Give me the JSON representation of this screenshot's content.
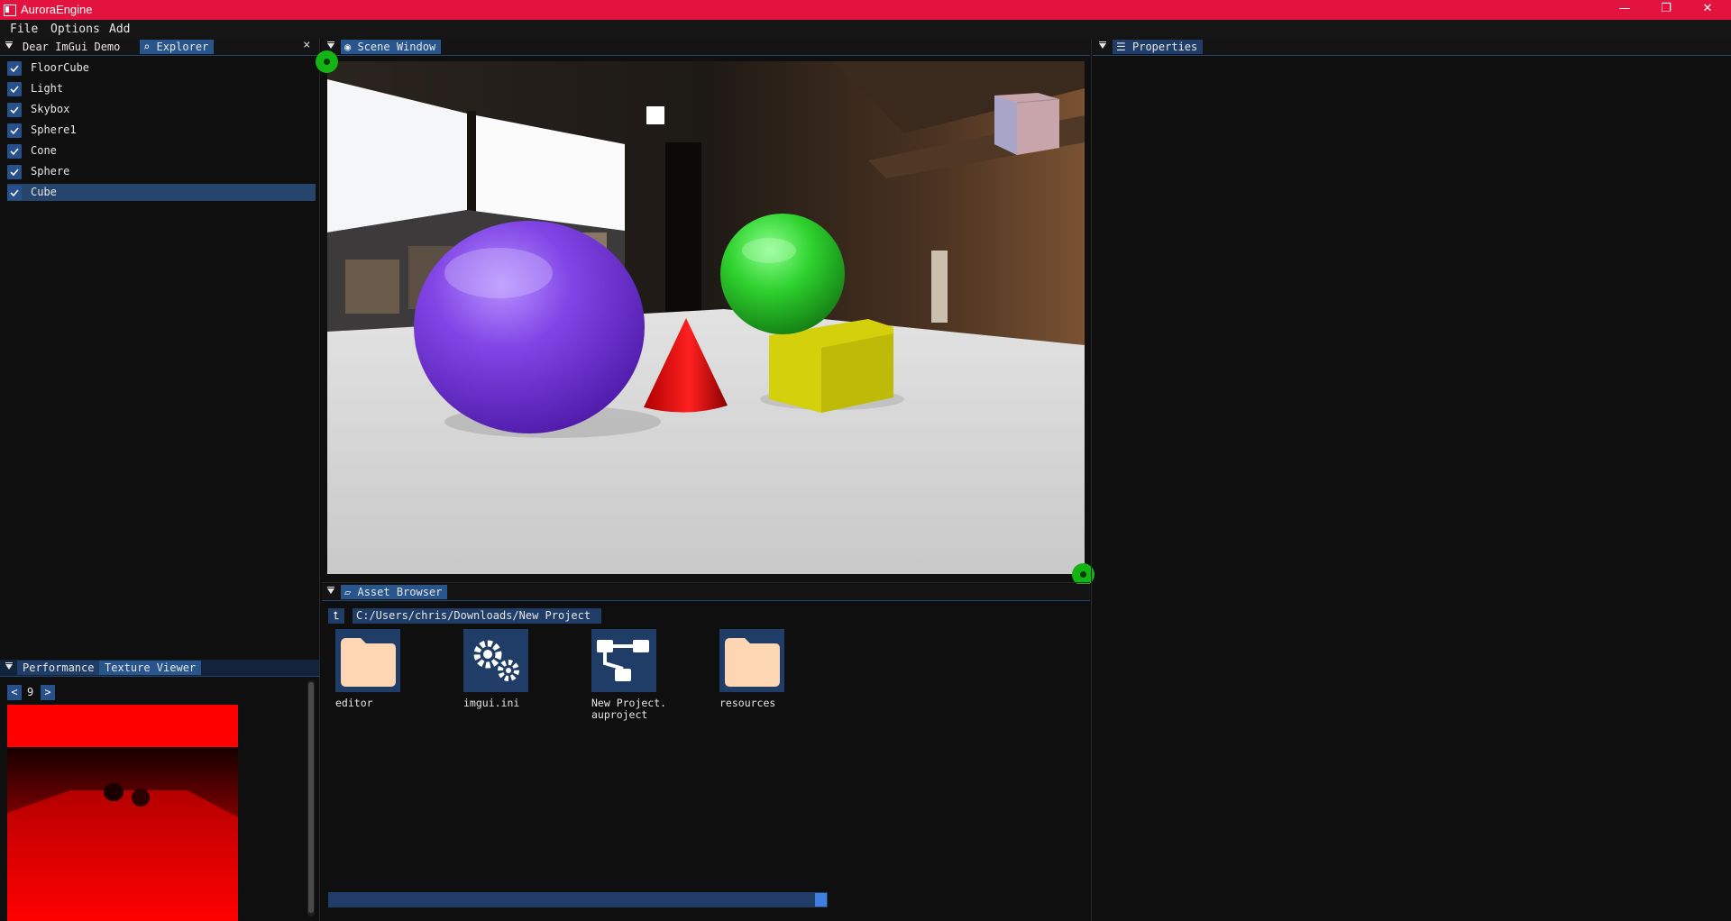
{
  "window": {
    "title": "AuroraEngine",
    "minimize": "—",
    "restore": "❐",
    "close": "✕"
  },
  "menu": [
    "File",
    "Options",
    "Add"
  ],
  "left_top_dock": {
    "tabs": [
      "Dear ImGui Demo",
      "Explorer"
    ],
    "close_glyph": "×",
    "explorer_items": [
      {
        "label": "FloorCube",
        "checked": true
      },
      {
        "label": "Light",
        "checked": true
      },
      {
        "label": "Skybox",
        "checked": true
      },
      {
        "label": "Sphere1",
        "checked": true
      },
      {
        "label": "Cone",
        "checked": true
      },
      {
        "label": "Sphere",
        "checked": true
      },
      {
        "label": "Cube",
        "checked": true,
        "selected": true
      }
    ]
  },
  "left_bottom_dock": {
    "tabs": [
      "Performance",
      "Texture Viewer"
    ],
    "prev": "<",
    "next": ">",
    "index": "9"
  },
  "scene_window": {
    "tab": "Scene Window"
  },
  "asset_browser": {
    "tab": "Asset Browser",
    "path": "C:/Users/chris/Downloads/New Project",
    "up_glyph": "⮤",
    "items": [
      {
        "label": "editor",
        "icon": "folder-icon"
      },
      {
        "label": "imgui.ini",
        "icon": "gears-icon"
      },
      {
        "label": "New Project.\nauproject",
        "icon": "project-graph-icon"
      },
      {
        "label": "resources",
        "icon": "folder-icon"
      }
    ]
  },
  "properties": {
    "tab": "Properties"
  },
  "colors": {
    "titlebar": "#e3133f",
    "tab_active": "#28558c",
    "checkbox": "#28508a",
    "folder": "#fdd7b4",
    "gizmo_green": "#14b414"
  }
}
